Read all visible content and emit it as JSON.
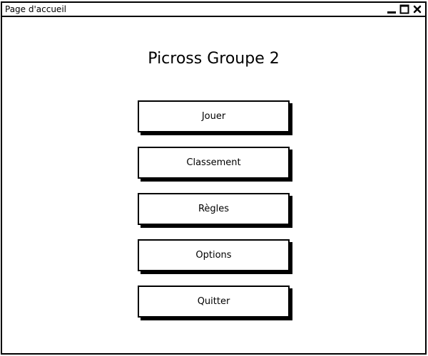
{
  "window": {
    "title": "Page d'accueil",
    "controls": {
      "minimize_icon": "minimize-icon",
      "maximize_icon": "maximize-icon",
      "close_icon": "close-icon"
    }
  },
  "main": {
    "title": "Picross Groupe 2",
    "buttons": [
      {
        "label": "Jouer"
      },
      {
        "label": "Classement"
      },
      {
        "label": "Règles"
      },
      {
        "label": "Options"
      },
      {
        "label": "Quitter"
      }
    ]
  },
  "colors": {
    "background": "#ffffff",
    "foreground": "#000000"
  }
}
